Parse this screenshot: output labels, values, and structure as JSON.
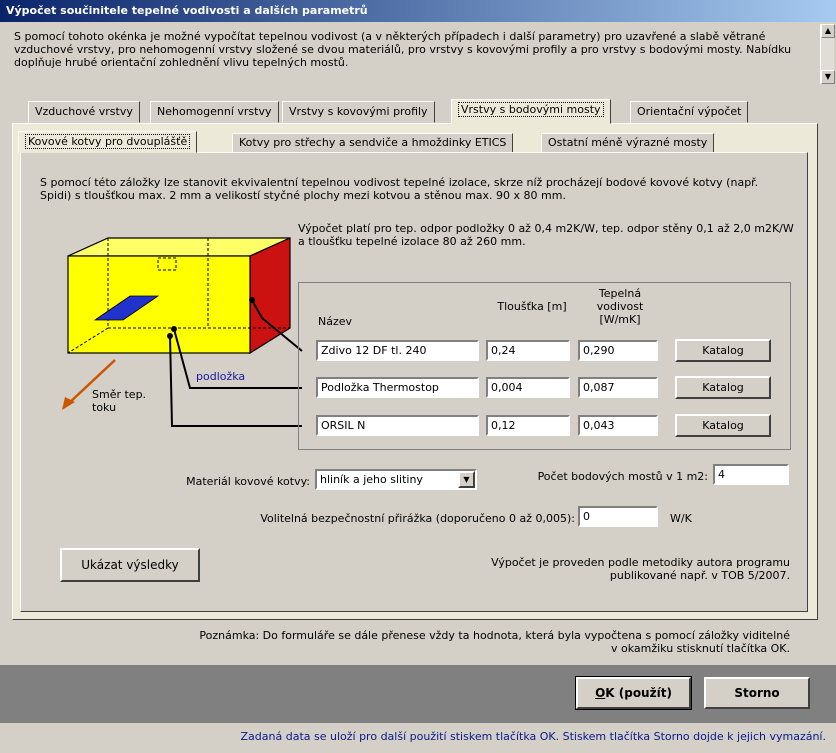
{
  "window": {
    "title": "Výpočet součinitele tepelné vodivosti a dalších parametrů"
  },
  "intro": "S pomocí tohoto okénka je možné vypočítat tepelnou vodivost (a v některých případech i další parametry) pro uzavřené a slabě větrané vzduchové vrstvy, pro nehomogenní vrstvy složené se dvou materiálů, pro vrstvy s kovovými profily a pro vrstvy s bodovými mosty. Nabídku doplňuje hrubé orientační zohlednění vlivu tepelných mostů.",
  "main_tabs": [
    "Vzduchové vrstvy",
    "Nehomogenní vrstvy",
    "Vrstvy s kovovými profily",
    "Vrstvy s bodovými mosty",
    "Orientační výpočet"
  ],
  "sub_tabs": [
    "Kovové kotvy pro dvouplášťě",
    "Kotvy pro střechy a sendviče a hmoždinky ETICS",
    "Ostatní méně výrazné mosty"
  ],
  "description": "S pomocí této záložky lze stanovit ekvivalentní tepelnou vodivost tepelné izolace, skrze níž procházejí bodové kovové kotvy (např. Spidi) s tloušťkou max. 2 mm a velikostí styčné plochy mezi kotvou a stěnou max. 90 x 80 mm.",
  "validity": "Výpočet platí pro tep. odpor podložky 0 až 0,4 m2K/W, tep. odpor stěny 0,1 až 2,0 m2K/W a tloušťku tepelné izolace 80 až 260 mm.",
  "diagram": {
    "podlozka_label": "podložka",
    "flow_label": "Směr tep. toku",
    "colors": {
      "front": "#ffff00",
      "side": "#cc1111",
      "anchor": "#2233cc",
      "arrow": "#cc5500"
    }
  },
  "table": {
    "headers": {
      "name": "Název",
      "thickness": "Tloušťka [m]",
      "conductivity": "Tepelná vodivost [W/mK]"
    },
    "rows": [
      {
        "name": "Zdivo 12 DF tl. 240",
        "thickness": "0,24",
        "conductivity": "0,290",
        "button": "Katalog"
      },
      {
        "name": "Podložka Thermostop",
        "thickness": "0,004",
        "conductivity": "0,087",
        "button": "Katalog"
      },
      {
        "name": "ORSIL N",
        "thickness": "0,12",
        "conductivity": "0,043",
        "button": "Katalog"
      }
    ]
  },
  "anchor_material": {
    "label": "Materiál kovové kotvy:",
    "value": "hliník a jeho slitiny"
  },
  "bridges_count": {
    "label": "Počet bodových mostů v 1 m2:",
    "value": "4"
  },
  "safety": {
    "label": "Volitelná bezpečnostní přirážka (doporučeno 0 až 0,005):",
    "value": "0",
    "unit": "W/K"
  },
  "show_results_button": "Ukázat výsledky",
  "method_note": "Výpočet je proveden podle metodiky autora programu publikované např. v TOB 5/2007.",
  "note": "Poznámka: Do formuláře se dále přenese vždy ta hodnota, která byla vypočtena s pomocí záložky viditelné v okamžiku stisknutí tlačítka OK.",
  "ok_button": {
    "accel": "O",
    "rest": "K (použít)"
  },
  "cancel_button": "Storno",
  "bottom_note": "Zadaná data se uloží pro další použití stiskem tlačítka OK. Stiskem tlačítka Storno dojde k jejich vymazání."
}
